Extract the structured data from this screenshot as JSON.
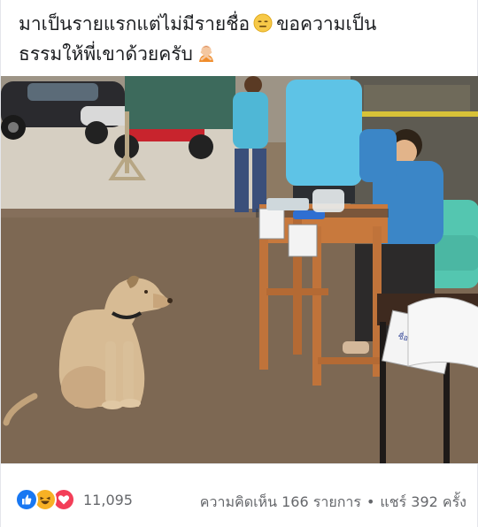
{
  "post": {
    "caption_line1": "มาเป็นรายแรกแต่ไม่มีรายชื่อ",
    "caption_line1_emoji": "expressionless-face-emoji",
    "caption_line1_cont": "ขอความเป็น",
    "caption_line2": "ธรรมให้พี่เขาด้วยครับ",
    "caption_line2_emoji": "person-gesturing-no-emoji"
  },
  "photo": {
    "description_icon": "photo",
    "sign_text": "ชื่อ"
  },
  "reactions": {
    "icons": [
      "like-icon",
      "haha-icon",
      "love-icon"
    ],
    "count": "11,095"
  },
  "stats": {
    "comments": "ความคิดเห็น 166 รายการ",
    "separator": "•",
    "shares": "แชร์ 392 ครั้ง"
  },
  "colors": {
    "like": "#1877f2",
    "haha": "#f7b125",
    "love": "#f33e58",
    "text_secondary": "#65676b"
  }
}
